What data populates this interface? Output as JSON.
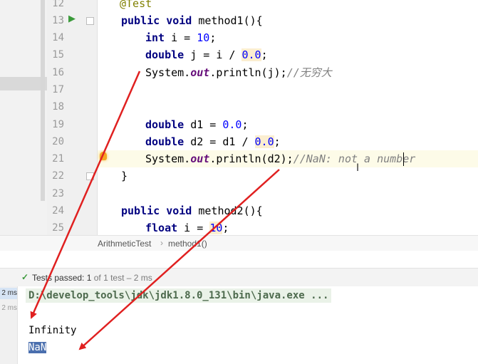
{
  "editor": {
    "line_numbers": [
      "12",
      "13",
      "14",
      "15",
      "16",
      "17",
      "18",
      "19",
      "20",
      "21",
      "22",
      "23",
      "24",
      "25"
    ],
    "lines": {
      "l12": {
        "annotation": "@Test"
      },
      "l13": {
        "kw": "public void",
        "rest": " method1(){"
      },
      "l14": {
        "kw": "int",
        "rest1": " i = ",
        "num": "10",
        "rest2": ";"
      },
      "l15": {
        "kw": "double",
        "rest1": " j = i / ",
        "num": "0.0",
        "rest2": ";"
      },
      "l16": {
        "cls": "System.",
        "field": "out",
        "call": ".println(j);",
        "comment": "//无穷大"
      },
      "l19": {
        "kw": "double",
        "rest1": " d1 = ",
        "num": "0.0",
        "rest2": ";"
      },
      "l20": {
        "kw": "double",
        "rest1": " d2 = d1 / ",
        "num": "0.0",
        "rest2": ";"
      },
      "l21": {
        "cls": "System.",
        "field": "out",
        "call": ".println(d2);",
        "comment": "//NaN: not a number"
      },
      "l22": {
        "brace": "}"
      },
      "l24": {
        "kw": "public void",
        "rest": " method2(){"
      },
      "l25": {
        "kw": "float",
        "rest1": " i = ",
        "num": "10",
        "rest2": ";"
      }
    }
  },
  "breadcrumb": {
    "class_name": "ArithmeticTest",
    "separator": "›",
    "method_name": "method1()"
  },
  "test_status": {
    "check_icon": "check-icon",
    "label": "Tests passed: ",
    "passed": "1",
    "of_text": " of 1 test – 2 ms"
  },
  "run_panel": {
    "time_a": "2 ms",
    "time_b": "2 ms",
    "command": "D:\\develop_tools\\jdk\\jdk1.8.0_131\\bin\\java.exe ...",
    "output": [
      "Infinity",
      "NaN"
    ]
  },
  "colors": {
    "keyword": "#000080",
    "number": "#0000ff",
    "field": "#660e7a",
    "comment": "#808080",
    "arrow": "#e02020",
    "selection": "#4a6fae"
  }
}
